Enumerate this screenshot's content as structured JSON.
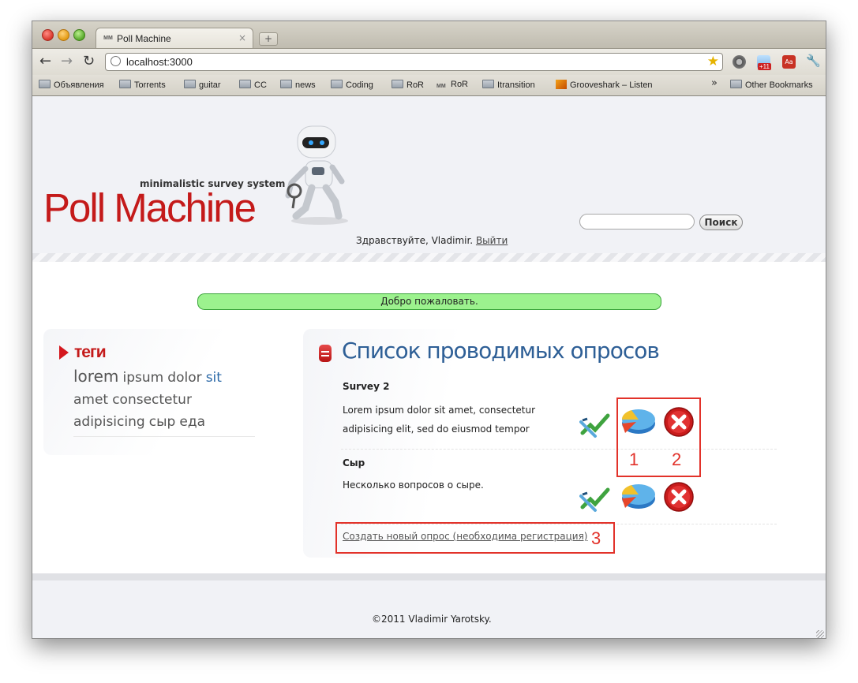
{
  "browser": {
    "tab_title": "Poll Machine",
    "tab_favicon": "MM",
    "tab_close": "×",
    "new_tab": "+",
    "url": "localhost:3000",
    "bookmarks": [
      "Объявления",
      "Torrents",
      "guitar",
      "CC",
      "news",
      "Coding",
      "RoR",
      "RoR",
      "Itransition",
      "Grooveshark – Listen"
    ],
    "bookmarks_more": "»",
    "other_bookmarks": "Other Bookmarks",
    "weather_badge": "+11",
    "ext_aa": "Aa"
  },
  "header": {
    "tagline": "minimalistic survey system",
    "logo": "Poll Machine",
    "search_button": "Поиск",
    "search_value": "",
    "greeting": "Здравствуйте, Vladimir.",
    "logout": "Выйти"
  },
  "flash": "Добро пожаловать.",
  "tags": {
    "title": "теги",
    "items": [
      {
        "text": "lorem",
        "size": "lg"
      },
      {
        "text": "ipsum",
        "size": "md"
      },
      {
        "text": "dolor",
        "size": "md"
      },
      {
        "text": "sit",
        "size": "md",
        "highlight": true
      },
      {
        "text": "amet",
        "size": "md"
      },
      {
        "text": "consectetur",
        "size": "md"
      },
      {
        "text": "adipisicing",
        "size": "md"
      },
      {
        "text": "сыр",
        "size": "md"
      },
      {
        "text": "еда",
        "size": "md"
      }
    ]
  },
  "surveys": {
    "title": "Список проводимых опросов",
    "items": [
      {
        "name": "Survey 2",
        "description": "Lorem ipsum dolor sit amet, consectetur adipisicing elit, sed do eiusmod tempor"
      },
      {
        "name": "Сыр",
        "description": "Несколько вопросов о сыре."
      }
    ],
    "create_link": "Создать новый опрос (необходима регистрация)"
  },
  "annotations": {
    "one": "1",
    "two": "2",
    "three": "3"
  },
  "footer": "©2011 Vladimir Yarotsky.",
  "colors": {
    "brand_red": "#c41a1a",
    "title_blue": "#2e5f96",
    "flash_green": "#9cf28e",
    "annotation_red": "#e2322a"
  }
}
